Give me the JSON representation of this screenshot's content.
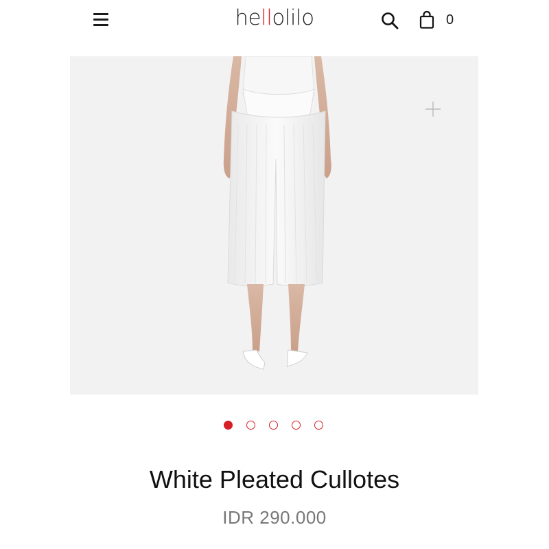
{
  "header": {
    "logo_pre": "he",
    "logo_accent": "ll",
    "logo_post": "olilo",
    "cart_count": "0",
    "accent_color": "#d71f26"
  },
  "icons": {
    "menu": "hamburger-menu-icon",
    "search": "search-icon",
    "cart": "shopping-bag-icon",
    "zoom": "plus-zoom-icon"
  },
  "gallery": {
    "image_count": 5,
    "active_index": 0
  },
  "product": {
    "title": "White Pleated Cullotes",
    "price": "IDR 290.000"
  }
}
